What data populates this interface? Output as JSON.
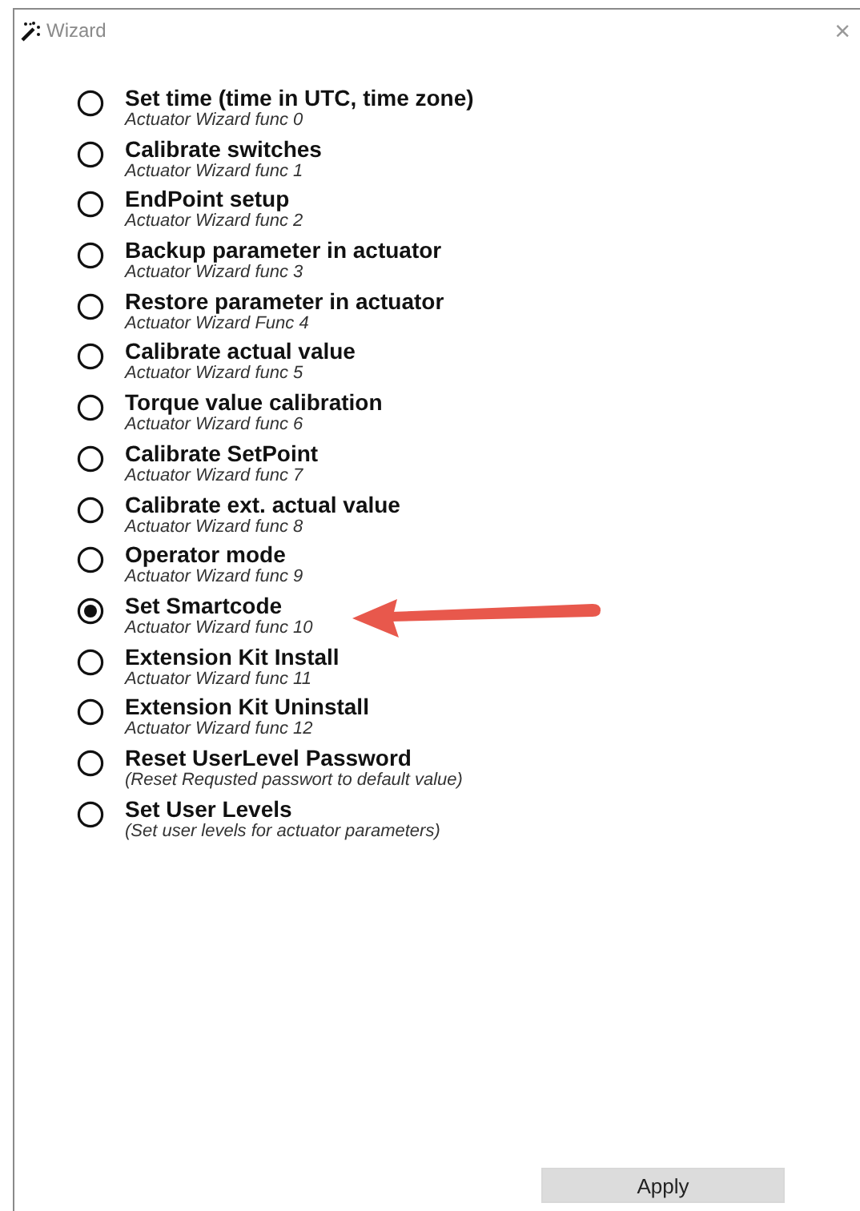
{
  "window": {
    "title": "Wizard",
    "close": "×"
  },
  "options": [
    {
      "title": "Set time (time in UTC, time zone)",
      "subtitle": "Actuator Wizard func 0",
      "selected": false
    },
    {
      "title": "Calibrate switches",
      "subtitle": "Actuator Wizard func 1",
      "selected": false
    },
    {
      "title": "EndPoint setup",
      "subtitle": "Actuator Wizard func 2",
      "selected": false
    },
    {
      "title": "Backup parameter in actuator",
      "subtitle": "Actuator Wizard func 3",
      "selected": false
    },
    {
      "title": "Restore parameter in actuator",
      "subtitle": "Actuator Wizard Func 4",
      "selected": false
    },
    {
      "title": "Calibrate actual value",
      "subtitle": "Actuator Wizard func 5",
      "selected": false
    },
    {
      "title": "Torque value calibration",
      "subtitle": "Actuator Wizard func 6",
      "selected": false
    },
    {
      "title": "Calibrate SetPoint",
      "subtitle": "Actuator Wizard func 7",
      "selected": false
    },
    {
      "title": "Calibrate ext. actual value",
      "subtitle": "Actuator Wizard func 8",
      "selected": false
    },
    {
      "title": "Operator mode",
      "subtitle": "Actuator Wizard func 9",
      "selected": false
    },
    {
      "title": "Set Smartcode",
      "subtitle": "Actuator Wizard func 10",
      "selected": true
    },
    {
      "title": "Extension Kit Install",
      "subtitle": "Actuator Wizard func 11",
      "selected": false
    },
    {
      "title": "Extension Kit Uninstall",
      "subtitle": "Actuator Wizard func 12",
      "selected": false
    },
    {
      "title": "Reset UserLevel Password",
      "subtitle": "(Reset Requsted passwort to default value)",
      "selected": false
    },
    {
      "title": "Set User Levels",
      "subtitle": "(Set user levels for actuator parameters)",
      "selected": false
    }
  ],
  "apply_button": "Apply"
}
